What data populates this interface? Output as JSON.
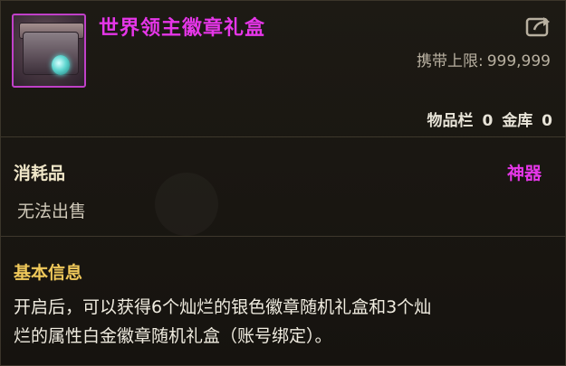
{
  "item": {
    "name": "世界领主徽章礼盒",
    "name_color": "#e536e8",
    "rarity_color": "#e536e8"
  },
  "carry": {
    "label": "携带上限:",
    "value": "999,999"
  },
  "storage": {
    "inventory_label": "物品栏",
    "inventory_count": "0",
    "vault_label": "金库",
    "vault_count": "0"
  },
  "category": {
    "type": "消耗品",
    "rarity": "神器",
    "trade_note": "无法出售"
  },
  "info": {
    "title": "基本信息",
    "line1": "开启后，可以获得6个灿烂的银色徽章随机礼盒和3个灿",
    "line2": "烂的属性白金徽章随机礼盒（账号绑定）。"
  },
  "icons": {
    "item_icon": "gift-box-icon",
    "share_icon": "share-arrow-icon"
  }
}
